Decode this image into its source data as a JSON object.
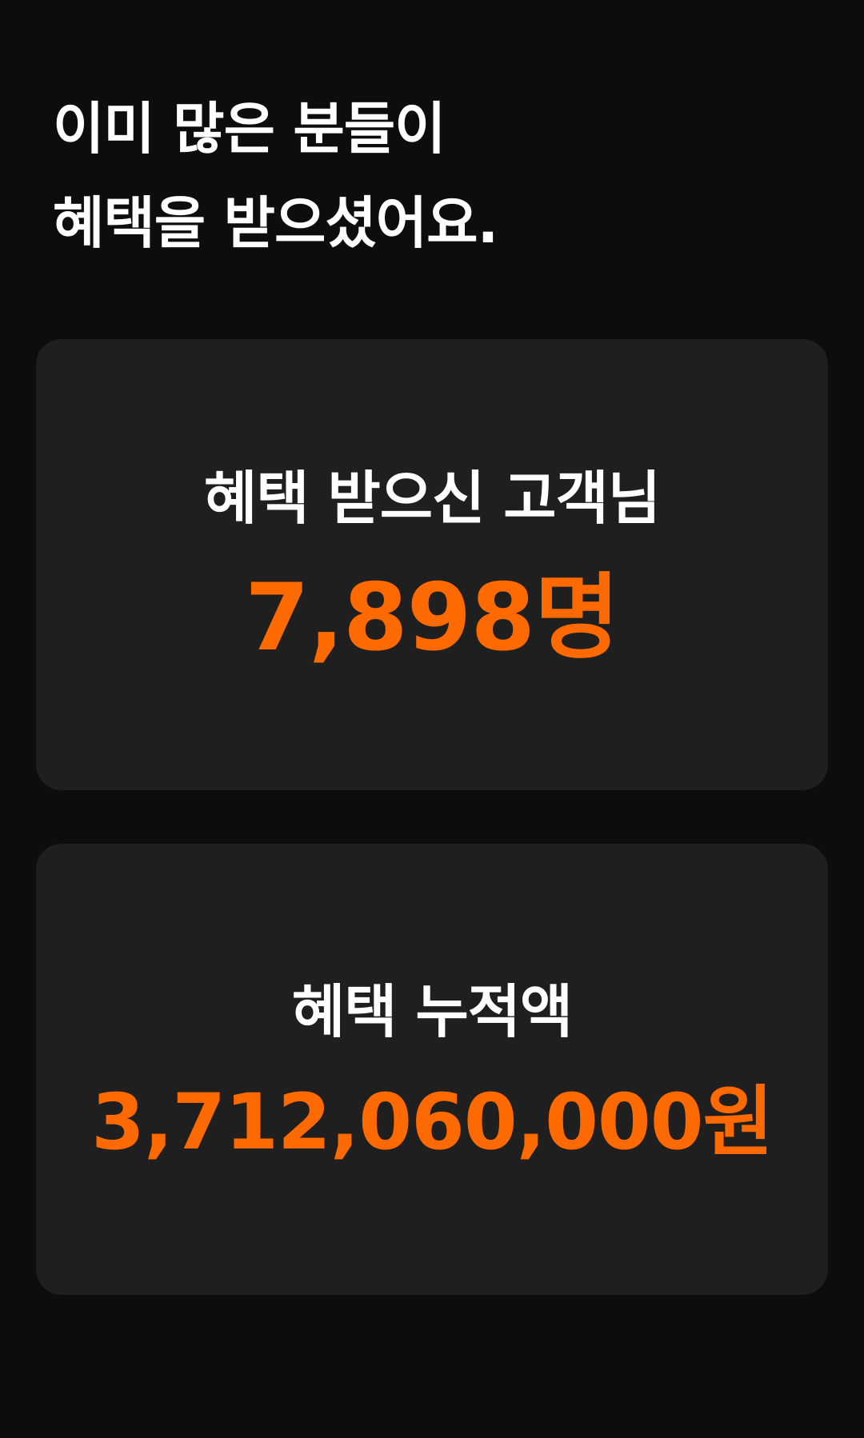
{
  "headline": {
    "line1": "이미 많은 분들이",
    "line2": "혜택을 받으셨어요."
  },
  "cards": [
    {
      "label": "혜택 받으신 고객님",
      "value": "7,898명"
    },
    {
      "label": "혜택 누적액",
      "value": "3,712,060,000원"
    }
  ],
  "colors": {
    "background": "#0d0d0d",
    "card": "#1f1f1f",
    "accent": "#ff6a00",
    "text": "#ffffff"
  }
}
